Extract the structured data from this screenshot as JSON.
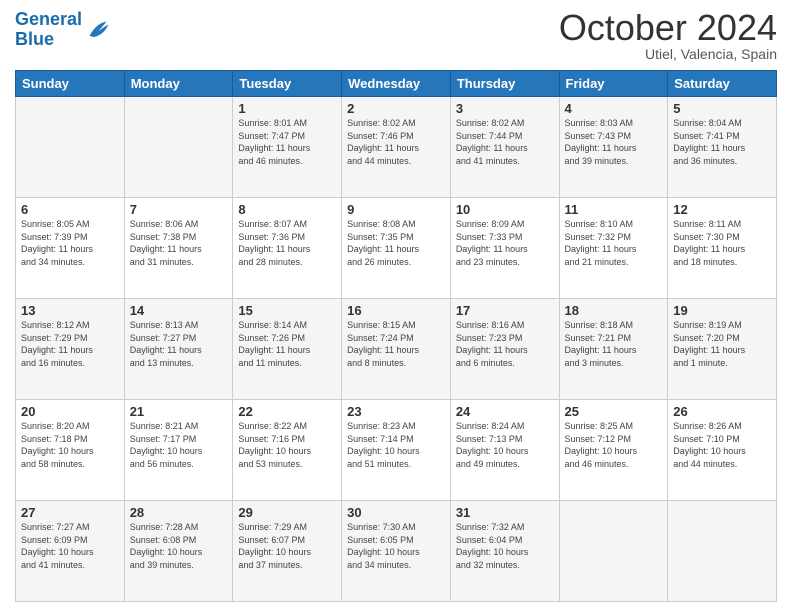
{
  "logo": {
    "line1": "General",
    "line2": "Blue"
  },
  "title": "October 2024",
  "location": "Utiel, Valencia, Spain",
  "days_header": [
    "Sunday",
    "Monday",
    "Tuesday",
    "Wednesday",
    "Thursday",
    "Friday",
    "Saturday"
  ],
  "weeks": [
    [
      {
        "day": "",
        "info": ""
      },
      {
        "day": "",
        "info": ""
      },
      {
        "day": "1",
        "info": "Sunrise: 8:01 AM\nSunset: 7:47 PM\nDaylight: 11 hours\nand 46 minutes."
      },
      {
        "day": "2",
        "info": "Sunrise: 8:02 AM\nSunset: 7:46 PM\nDaylight: 11 hours\nand 44 minutes."
      },
      {
        "day": "3",
        "info": "Sunrise: 8:02 AM\nSunset: 7:44 PM\nDaylight: 11 hours\nand 41 minutes."
      },
      {
        "day": "4",
        "info": "Sunrise: 8:03 AM\nSunset: 7:43 PM\nDaylight: 11 hours\nand 39 minutes."
      },
      {
        "day": "5",
        "info": "Sunrise: 8:04 AM\nSunset: 7:41 PM\nDaylight: 11 hours\nand 36 minutes."
      }
    ],
    [
      {
        "day": "6",
        "info": "Sunrise: 8:05 AM\nSunset: 7:39 PM\nDaylight: 11 hours\nand 34 minutes."
      },
      {
        "day": "7",
        "info": "Sunrise: 8:06 AM\nSunset: 7:38 PM\nDaylight: 11 hours\nand 31 minutes."
      },
      {
        "day": "8",
        "info": "Sunrise: 8:07 AM\nSunset: 7:36 PM\nDaylight: 11 hours\nand 28 minutes."
      },
      {
        "day": "9",
        "info": "Sunrise: 8:08 AM\nSunset: 7:35 PM\nDaylight: 11 hours\nand 26 minutes."
      },
      {
        "day": "10",
        "info": "Sunrise: 8:09 AM\nSunset: 7:33 PM\nDaylight: 11 hours\nand 23 minutes."
      },
      {
        "day": "11",
        "info": "Sunrise: 8:10 AM\nSunset: 7:32 PM\nDaylight: 11 hours\nand 21 minutes."
      },
      {
        "day": "12",
        "info": "Sunrise: 8:11 AM\nSunset: 7:30 PM\nDaylight: 11 hours\nand 18 minutes."
      }
    ],
    [
      {
        "day": "13",
        "info": "Sunrise: 8:12 AM\nSunset: 7:29 PM\nDaylight: 11 hours\nand 16 minutes."
      },
      {
        "day": "14",
        "info": "Sunrise: 8:13 AM\nSunset: 7:27 PM\nDaylight: 11 hours\nand 13 minutes."
      },
      {
        "day": "15",
        "info": "Sunrise: 8:14 AM\nSunset: 7:26 PM\nDaylight: 11 hours\nand 11 minutes."
      },
      {
        "day": "16",
        "info": "Sunrise: 8:15 AM\nSunset: 7:24 PM\nDaylight: 11 hours\nand 8 minutes."
      },
      {
        "day": "17",
        "info": "Sunrise: 8:16 AM\nSunset: 7:23 PM\nDaylight: 11 hours\nand 6 minutes."
      },
      {
        "day": "18",
        "info": "Sunrise: 8:18 AM\nSunset: 7:21 PM\nDaylight: 11 hours\nand 3 minutes."
      },
      {
        "day": "19",
        "info": "Sunrise: 8:19 AM\nSunset: 7:20 PM\nDaylight: 11 hours\nand 1 minute."
      }
    ],
    [
      {
        "day": "20",
        "info": "Sunrise: 8:20 AM\nSunset: 7:18 PM\nDaylight: 10 hours\nand 58 minutes."
      },
      {
        "day": "21",
        "info": "Sunrise: 8:21 AM\nSunset: 7:17 PM\nDaylight: 10 hours\nand 56 minutes."
      },
      {
        "day": "22",
        "info": "Sunrise: 8:22 AM\nSunset: 7:16 PM\nDaylight: 10 hours\nand 53 minutes."
      },
      {
        "day": "23",
        "info": "Sunrise: 8:23 AM\nSunset: 7:14 PM\nDaylight: 10 hours\nand 51 minutes."
      },
      {
        "day": "24",
        "info": "Sunrise: 8:24 AM\nSunset: 7:13 PM\nDaylight: 10 hours\nand 49 minutes."
      },
      {
        "day": "25",
        "info": "Sunrise: 8:25 AM\nSunset: 7:12 PM\nDaylight: 10 hours\nand 46 minutes."
      },
      {
        "day": "26",
        "info": "Sunrise: 8:26 AM\nSunset: 7:10 PM\nDaylight: 10 hours\nand 44 minutes."
      }
    ],
    [
      {
        "day": "27",
        "info": "Sunrise: 7:27 AM\nSunset: 6:09 PM\nDaylight: 10 hours\nand 41 minutes."
      },
      {
        "day": "28",
        "info": "Sunrise: 7:28 AM\nSunset: 6:08 PM\nDaylight: 10 hours\nand 39 minutes."
      },
      {
        "day": "29",
        "info": "Sunrise: 7:29 AM\nSunset: 6:07 PM\nDaylight: 10 hours\nand 37 minutes."
      },
      {
        "day": "30",
        "info": "Sunrise: 7:30 AM\nSunset: 6:05 PM\nDaylight: 10 hours\nand 34 minutes."
      },
      {
        "day": "31",
        "info": "Sunrise: 7:32 AM\nSunset: 6:04 PM\nDaylight: 10 hours\nand 32 minutes."
      },
      {
        "day": "",
        "info": ""
      },
      {
        "day": "",
        "info": ""
      }
    ]
  ]
}
